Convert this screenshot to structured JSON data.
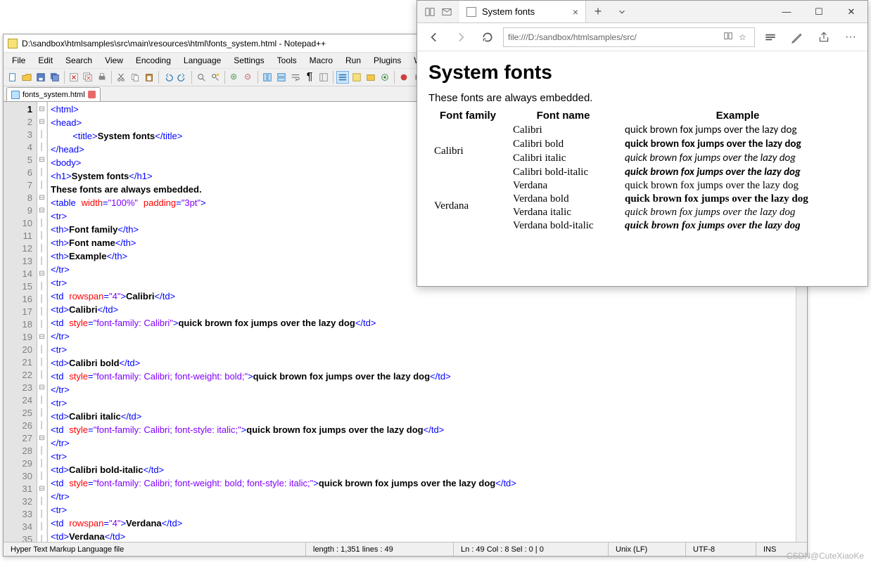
{
  "notepad": {
    "title": "D:\\sandbox\\htmlsamples\\src\\main\\resources\\html\\fonts_system.html - Notepad++",
    "menu": [
      "File",
      "Edit",
      "Search",
      "View",
      "Encoding",
      "Language",
      "Settings",
      "Tools",
      "Macro",
      "Run",
      "Plugins",
      "Window",
      "?"
    ],
    "tab_label": "fonts_system.html",
    "status": {
      "type": "Hyper Text Markup Language file",
      "length_lines": "length : 1,351    lines : 49",
      "pos": "Ln : 49    Col : 8    Sel : 0 | 0",
      "eol": "Unix (LF)",
      "enc": "UTF-8",
      "ins": "INS"
    },
    "code_txt": {
      "l3_title": "System fonts",
      "l6_h1": "System fonts",
      "l7_txt": "These fonts are always embedded.",
      "l10_th": "Font family",
      "l11_th": "Font name",
      "l12_th": "Example",
      "l15_td": "Calibri",
      "l16_td": "Calibri",
      "l17_ex": "quick brown fox jumps over the lazy dog",
      "l20_td": "Calibri bold",
      "l21_ex": "quick brown fox jumps over the lazy dog",
      "l24_td": "Calibri italic",
      "l25_ex": "quick brown fox jumps over the lazy dog",
      "l28_td": "Calibri bold-italic",
      "l29_ex": "quick brown fox jumps over the lazy dog",
      "l32_td": "Verdana",
      "l33_td": "Verdana",
      "l34_ex": "quick brown fox jumps over the lazy dog"
    },
    "attrs": {
      "width100": "\"100%\"",
      "pad3pt": "\"3pt\"",
      "rowspan4": "\"4\"",
      "style_cal": "\"font-family: Calibri\"",
      "style_cal_b": "\"font-family: Calibri; font-weight: bold;\"",
      "style_cal_i": "\"font-family: Calibri; font-style: italic;\"",
      "style_cal_bi": "\"font-family: Calibri; font-weight: bold; font-style: italic;\"",
      "style_ver": "\"font-family: Verdana\""
    }
  },
  "edge": {
    "tab_title": "System fonts",
    "url": "file:///D:/sandbox/htmlsamples/src/",
    "page": {
      "h1": "System fonts",
      "p": "These fonts are always embedded.",
      "th1": "Font family",
      "th2": "Font name",
      "th3": "Example",
      "rows": [
        {
          "family": "Calibri",
          "name": "Calibri",
          "style": "font-family:Calibri",
          "ex": "quick brown fox jumps over the lazy dog"
        },
        {
          "family": "",
          "name": "Calibri bold",
          "style": "font-family:Calibri;font-weight:bold",
          "ex": "quick brown fox jumps over the lazy dog"
        },
        {
          "family": "",
          "name": "Calibri italic",
          "style": "font-family:Calibri;font-style:italic",
          "ex": "quick brown fox jumps over the lazy dog"
        },
        {
          "family": "",
          "name": "Calibri bold-italic",
          "style": "font-family:Calibri;font-weight:bold;font-style:italic",
          "ex": "quick brown fox jumps over the lazy dog"
        },
        {
          "family": "Verdana",
          "name": "Verdana",
          "style": "font-family:Verdana",
          "ex": "quick brown fox jumps over the lazy dog"
        },
        {
          "family": "",
          "name": "Verdana bold",
          "style": "font-family:Verdana;font-weight:bold",
          "ex": "quick brown fox jumps over the lazy dog"
        },
        {
          "family": "",
          "name": "Verdana italic",
          "style": "font-family:Verdana;font-style:italic",
          "ex": "quick brown fox jumps over the lazy dog"
        },
        {
          "family": "",
          "name": "Verdana bold-italic",
          "style": "font-family:Verdana;font-weight:bold;font-style:italic",
          "ex": "quick brown fox jumps over the lazy dog"
        }
      ]
    }
  },
  "watermark": "CSDN@CuteXiaoKe"
}
